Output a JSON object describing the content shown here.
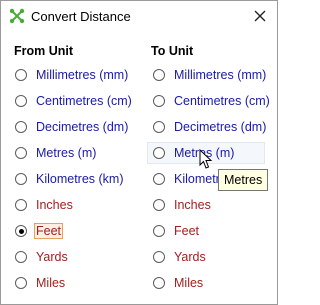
{
  "window": {
    "title": "Convert Distance"
  },
  "from_unit": {
    "header": "From Unit",
    "options": [
      {
        "label": "Millimetres (mm)",
        "checked": false,
        "red": false
      },
      {
        "label": "Centimetres (cm)",
        "checked": false,
        "red": false
      },
      {
        "label": "Decimetres (dm)",
        "checked": false,
        "red": false
      },
      {
        "label": "Metres (m)",
        "checked": false,
        "red": false
      },
      {
        "label": "Kilometres (km)",
        "checked": false,
        "red": false
      },
      {
        "label": "Inches",
        "checked": false,
        "red": true
      },
      {
        "label": "Feet",
        "checked": true,
        "red": true
      },
      {
        "label": "Yards",
        "checked": false,
        "red": true
      },
      {
        "label": "Miles",
        "checked": false,
        "red": true
      }
    ]
  },
  "to_unit": {
    "header": "To Unit",
    "options": [
      {
        "label": "Millimetres (mm)",
        "checked": false,
        "red": false
      },
      {
        "label": "Centimetres (cm)",
        "checked": false,
        "red": false
      },
      {
        "label": "Decimetres (dm)",
        "checked": false,
        "red": false
      },
      {
        "label": "Metres (m)",
        "checked": false,
        "red": false
      },
      {
        "label": "Kilometres (km)",
        "checked": false,
        "red": false
      },
      {
        "label": "Inches",
        "checked": false,
        "red": true
      },
      {
        "label": "Feet",
        "checked": false,
        "red": true
      },
      {
        "label": "Yards",
        "checked": false,
        "red": true
      },
      {
        "label": "Miles",
        "checked": false,
        "red": true
      }
    ]
  },
  "tooltip": {
    "text": "Metres"
  },
  "colors": {
    "metric_label": "#1a1aa8",
    "imperial_label": "#a32020",
    "icon_green": "#4caa3c"
  }
}
